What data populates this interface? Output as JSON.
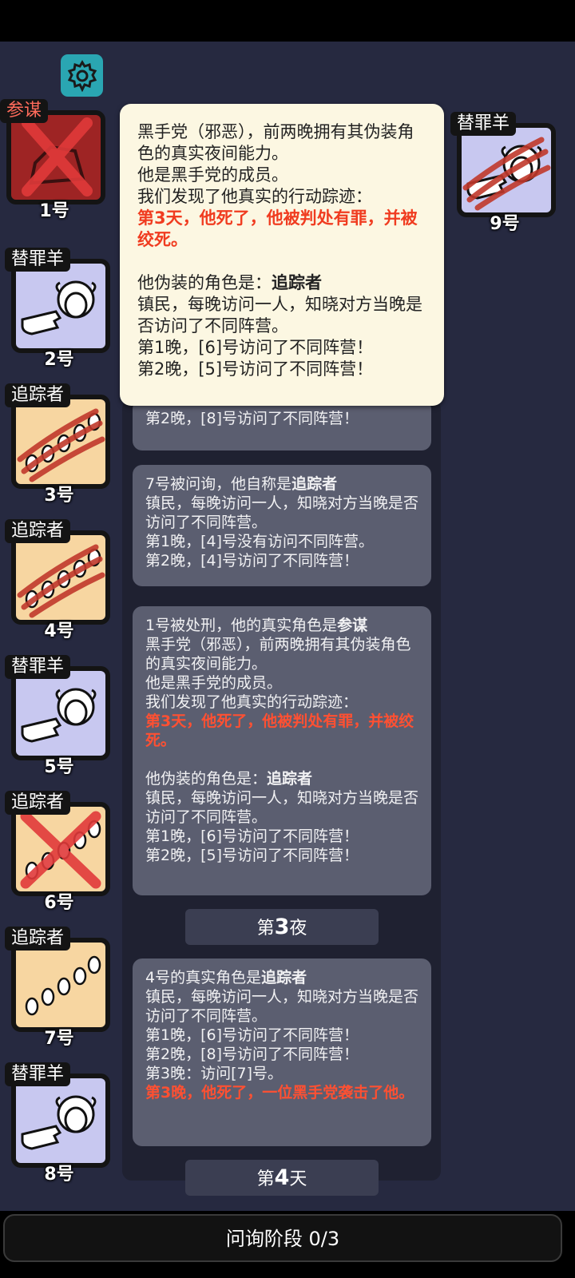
{
  "phase": {
    "label": "问询阶段",
    "progress": "0/3"
  },
  "players": [
    {
      "num": "1号",
      "role": "参谋",
      "icon": "broken-goblet-icon",
      "crossed": true
    },
    {
      "num": "2号",
      "role": "替罪羊",
      "icon": "sheep-pointing-icon"
    },
    {
      "num": "3号",
      "role": "追踪者",
      "icon": "footprints-icon",
      "clawed": true
    },
    {
      "num": "4号",
      "role": "追踪者",
      "icon": "footprints-icon",
      "clawed": true
    },
    {
      "num": "5号",
      "role": "替罪羊",
      "icon": "sheep-pointing-icon"
    },
    {
      "num": "6号",
      "role": "追踪者",
      "icon": "footprints-icon",
      "crossed": true
    },
    {
      "num": "7号",
      "role": "追踪者",
      "icon": "footprints-icon"
    },
    {
      "num": "8号",
      "role": "替罪羊",
      "icon": "sheep-pointing-icon"
    },
    {
      "num": "9号",
      "role": "替罪羊",
      "icon": "sheep-pointing-icon",
      "clawed": true
    }
  ],
  "popup": {
    "line1": "黑手党（邪恶），前两晚拥有其伪装角色的真实夜间能力。",
    "line2": "他是黑手党的成员。",
    "line3": "我们发现了他真实的行动踪迹：",
    "red": "第3天，他死了，他被判处有罪，并被绞死。",
    "disguise_prefix": "他伪装的角色是：",
    "disguise_role": "追踪者",
    "desc": "镇民，每晚访问一人，知晓对方当晚是否访问了不同阵营。",
    "n1": "第1晚，[6]号访问了不同阵营！",
    "n2": "第2晚，[5]号访问了不同阵营！"
  },
  "log": {
    "partial_tail": "第2晚，[8]号访问了不同阵营！",
    "entry7": {
      "prefix": "7号被问询，他自称是",
      "role": "追踪者",
      "desc": "镇民，每晚访问一人，知晓对方当晚是否访问了不同阵营。",
      "n1": "第1晚，[4]号没有访问不同阵营。",
      "n2": "第2晚，[4]号访问了不同阵营！"
    },
    "entry1": {
      "prefix": "1号被处刑，他的真实角色是",
      "role": "参谋",
      "line1": "黑手党（邪恶），前两晚拥有其伪装角色的真实夜间能力。",
      "line2": "他是黑手党的成员。",
      "line3": "我们发现了他真实的行动踪迹：",
      "red": "第3天，他死了，他被判处有罪，并被绞死。",
      "disguise_prefix": "他伪装的角色是：",
      "disguise_role": "追踪者",
      "desc": "镇民，每晚访问一人，知晓对方当晚是否访问了不同阵营。",
      "n1": "第1晚，[6]号访问了不同阵营！",
      "n2": "第2晚，[5]号访问了不同阵营！"
    },
    "night3": {
      "pre": "第",
      "num": "3",
      "post": "夜"
    },
    "entry4": {
      "prefix": "4号的真实角色是",
      "role": "追踪者",
      "desc": "镇民，每晚访问一人，知晓对方当晚是否访问了不同阵营。",
      "n1": "第1晚，[6]号访问了不同阵营！",
      "n2": "第2晚，[8]号访问了不同阵营！",
      "n3": "第3晚：访问[7]号。",
      "red": "第3晚，他死了，一位黑手党袭击了他。"
    },
    "day4": {
      "pre": "第",
      "num": "4",
      "post": "天"
    }
  }
}
